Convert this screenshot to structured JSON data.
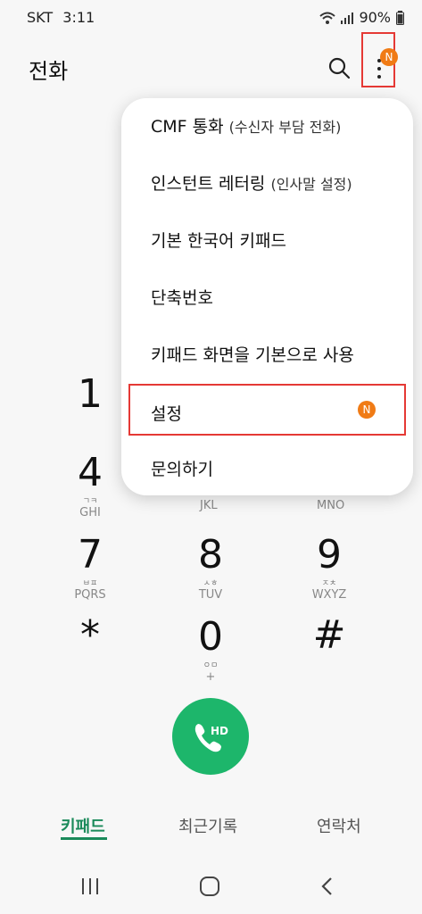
{
  "status_bar": {
    "carrier": "SKT",
    "time": "3:11",
    "battery": "90%"
  },
  "header": {
    "title": "전화"
  },
  "menu": {
    "items": [
      {
        "main": "CMF 통화",
        "sub": "(수신자 부담 전화)"
      },
      {
        "main": "인스턴트 레터링",
        "sub": "(인사말 설정)"
      },
      {
        "main": "기본 한국어 키패드",
        "sub": ""
      },
      {
        "main": "단축번호",
        "sub": ""
      },
      {
        "main": "키패드 화면을 기본으로 사용",
        "sub": ""
      },
      {
        "main": "설정",
        "sub": "",
        "badge": "N"
      },
      {
        "main": "문의하기",
        "sub": ""
      }
    ]
  },
  "badge_more": "N",
  "dialpad": {
    "k1": {
      "num": "1"
    },
    "k4": {
      "num": "4",
      "kor": "ㄱㅋ",
      "eng": "GHI"
    },
    "k5": {
      "eng": "JKL"
    },
    "k6": {
      "eng": "MNO"
    },
    "k7": {
      "num": "7",
      "kor": "ㅂㅍ",
      "eng": "PQRS"
    },
    "k8": {
      "num": "8",
      "kor": "ㅅㅎ",
      "eng": "TUV"
    },
    "k9": {
      "num": "9",
      "kor": "ㅈㅊ",
      "eng": "WXYZ"
    },
    "kstar": {
      "num": "*"
    },
    "k0": {
      "num": "0",
      "kor": "ㅇㅁ",
      "eng": "+"
    },
    "khash": {
      "num": "#"
    }
  },
  "call_button": {
    "label": "HD"
  },
  "tabs": {
    "keypad": "키패드",
    "recent": "최근기록",
    "contacts": "연락처"
  },
  "colors": {
    "accent_green": "#1db66b",
    "badge_orange": "#f07b15",
    "highlight_red": "#e53935"
  }
}
